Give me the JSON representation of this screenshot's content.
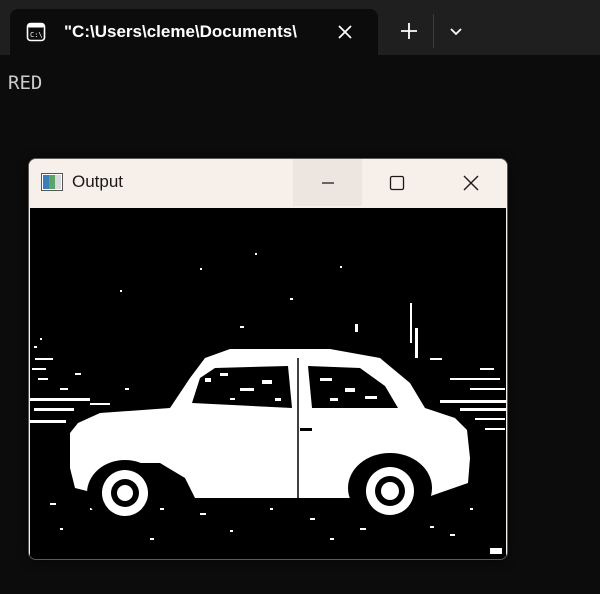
{
  "terminal": {
    "tab_title": "\"C:\\Users\\cleme\\Documents\\",
    "icons": {
      "tab": "cmd-icon",
      "close": "close-icon",
      "new_tab": "plus-icon",
      "dropdown": "chevron-down-icon"
    },
    "output_text": "RED"
  },
  "window": {
    "title": "Output",
    "icons": {
      "app": "app-icon",
      "minimize": "minimize-icon",
      "maximize": "maximize-icon",
      "close": "close-icon"
    }
  },
  "image": {
    "description_name": "binary-thresholded-car-image",
    "colors": {
      "background": "#000000",
      "foreground": "#ffffff"
    }
  }
}
